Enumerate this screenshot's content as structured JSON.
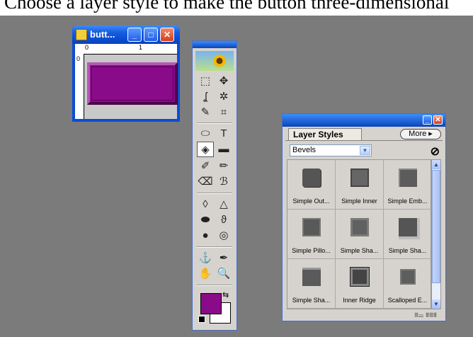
{
  "caption": "Choose a layer style to make the button three-dimensional",
  "document_window": {
    "title": "butt...",
    "ruler_marks": [
      "0",
      "1",
      "0"
    ],
    "button_color": "#8a0b8a"
  },
  "title_buttons": {
    "minimize": "_",
    "maximize": "□",
    "close": "✕"
  },
  "tools": {
    "icons": {
      "marquee": "⬚",
      "move": "✥",
      "lasso": "ʆ",
      "magic_wand": "✲",
      "crop_brush": "✎",
      "crop": "⌗",
      "shape": "⬭",
      "type": "T",
      "paint_bucket": "◈",
      "gradient": "▬",
      "brush": "✐",
      "pencil": "✏",
      "eraser": "⌫",
      "clone": "ℬ",
      "blur": "◊",
      "sharpen": "△",
      "sponge": "⬬",
      "smudge": "ϑ",
      "burn": "●",
      "dodge": "◎",
      "stamp": "⚓",
      "eyedropper": "✒",
      "hand": "✋",
      "zoom": "🔍",
      "swap": "⇆"
    },
    "foreground_color": "#8a0b8a",
    "background_color": "#ffffff"
  },
  "layer_styles": {
    "tab_label": "Layer Styles",
    "more_label": "More ▸",
    "dropdown_value": "Bevels",
    "dropdown_arrow": "▼",
    "clear_icon": "⊘",
    "items": [
      {
        "label": "Simple Out..."
      },
      {
        "label": "Simple Inner"
      },
      {
        "label": "Simple Emb..."
      },
      {
        "label": "Simple Pillo..."
      },
      {
        "label": "Simple Sha..."
      },
      {
        "label": "Simple Sha..."
      },
      {
        "label": "Simple Sha..."
      },
      {
        "label": "Inner Ridge"
      },
      {
        "label": "Scalloped E..."
      }
    ],
    "footer_icons": "⩩☰  ⩩⩩⩩"
  }
}
